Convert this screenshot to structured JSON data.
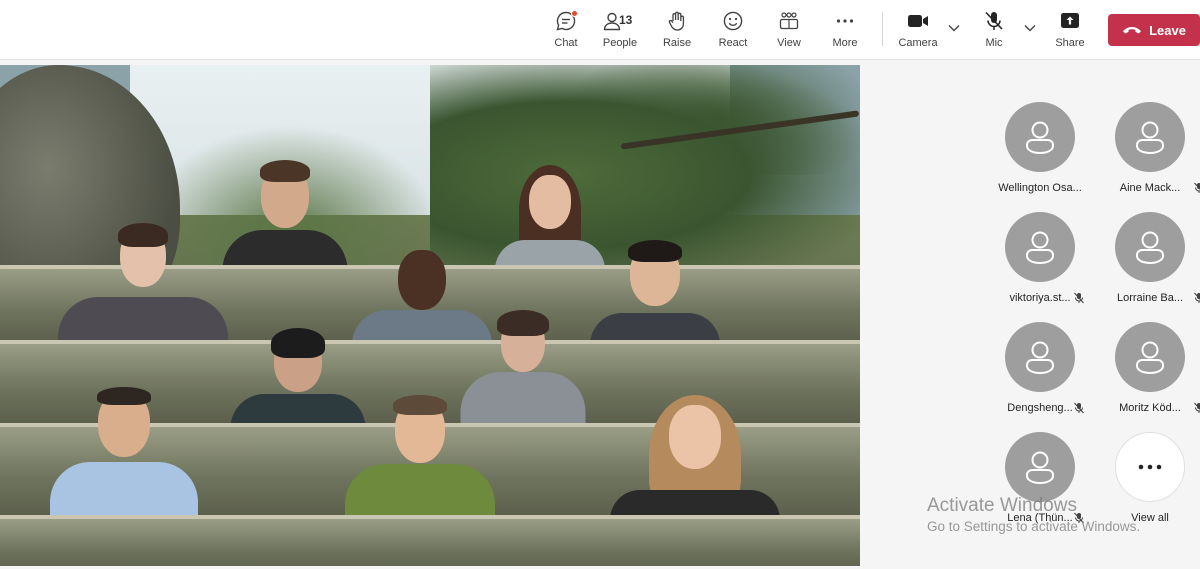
{
  "toolbar": {
    "chat": {
      "label": "Chat",
      "icon": "chat-icon"
    },
    "people": {
      "label": "People",
      "count": "13",
      "icon": "people-icon"
    },
    "raise": {
      "label": "Raise",
      "icon": "hand-icon"
    },
    "react": {
      "label": "React",
      "icon": "smiley-icon"
    },
    "view": {
      "label": "View",
      "icon": "grid-icon"
    },
    "more": {
      "label": "More",
      "icon": "ellipsis-icon"
    },
    "camera": {
      "label": "Camera",
      "icon": "video-camera-icon"
    },
    "mic": {
      "label": "Mic",
      "icon": "mic-off-icon"
    },
    "share": {
      "label": "Share",
      "icon": "share-tray-icon"
    },
    "leave": {
      "label": "Leave",
      "icon": "phone-hangup-icon",
      "color": "#c4314b"
    }
  },
  "participants": [
    {
      "name": "Wellington Osa...",
      "muted": false
    },
    {
      "name": "Aine Mack...",
      "muted": true
    },
    {
      "name": "viktoriya.st...",
      "muted": true
    },
    {
      "name": "Lorraine Ba...",
      "muted": true
    },
    {
      "name": "Dengsheng...",
      "muted": true
    },
    {
      "name": "Moritz Köd...",
      "muted": true
    },
    {
      "name": "Lena (Thün...",
      "muted": true
    }
  ],
  "view_all": {
    "label": "View all",
    "icon": "ellipsis-icon"
  },
  "watermark": {
    "line1": "Activate Windows",
    "line2": "Go to Settings to activate Windows."
  }
}
